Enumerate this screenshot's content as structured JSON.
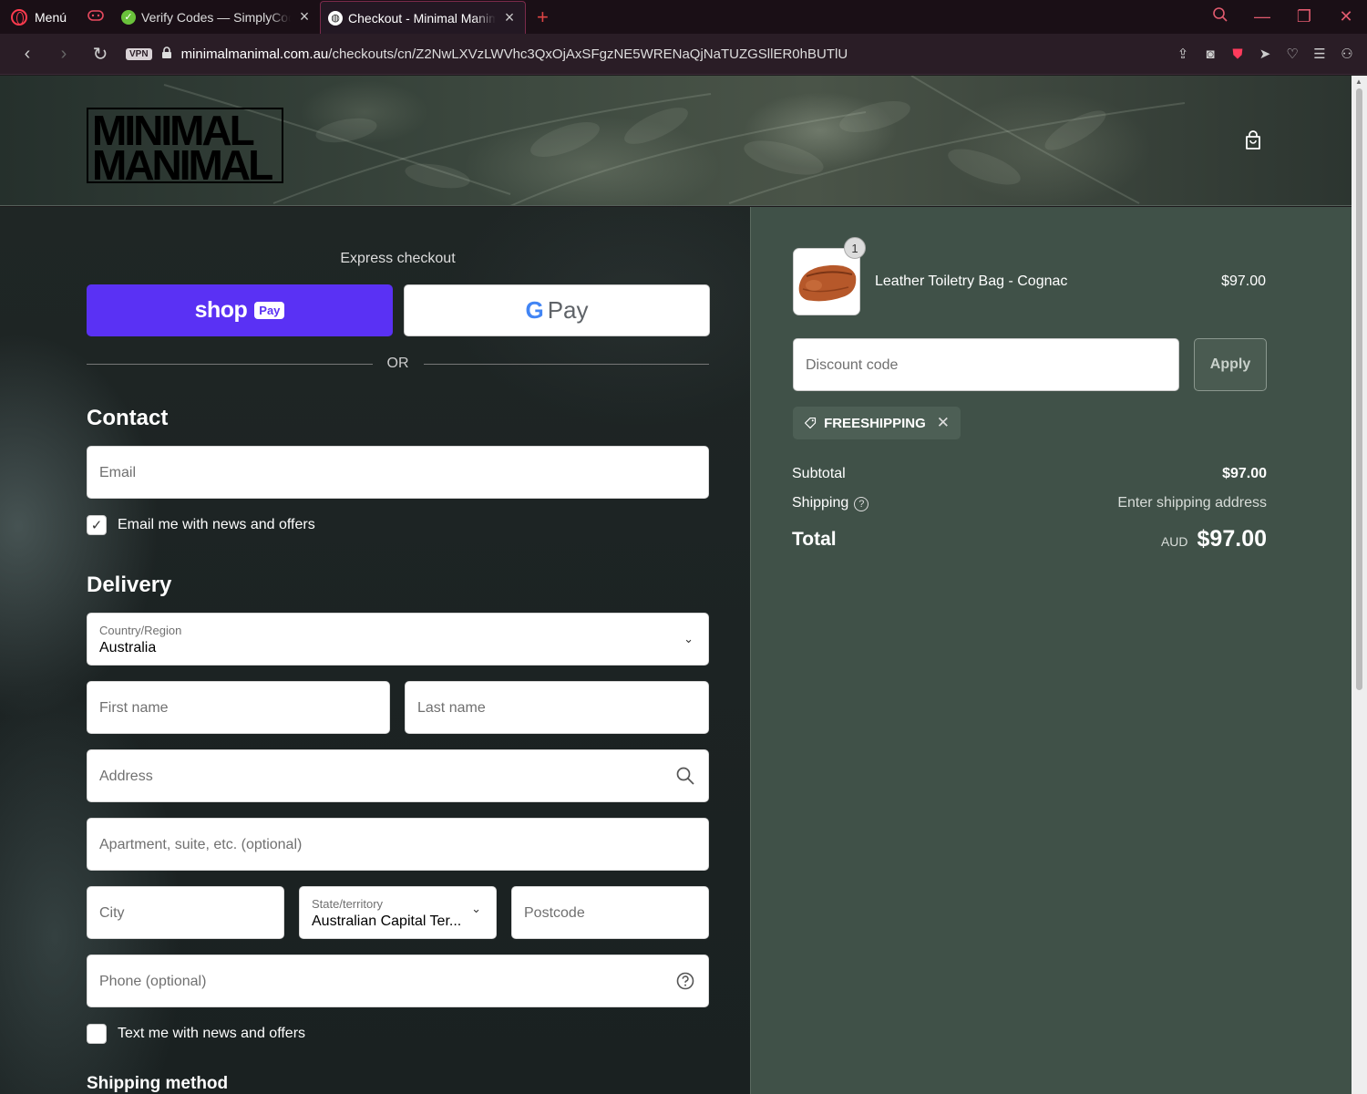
{
  "browser": {
    "menu_label": "Menú",
    "tabs": [
      {
        "title": "Verify Codes — SimplyCodes"
      },
      {
        "title": "Checkout - Minimal Manimal"
      }
    ],
    "vpn_label": "VPN",
    "url_host": "minimalmanimal.com.au",
    "url_path": "/checkouts/cn/Z2NwLXVzLWVhc3QxOjAxSFgzNE5WRENaQjNaTUZGSllER0hBUTlU"
  },
  "header": {
    "logo_line1": "MINIMAL",
    "logo_line2": "MANIMAL"
  },
  "checkout": {
    "express_label": "Express checkout",
    "shop_pay_word": "shop",
    "shop_pay_badge": "Pay",
    "gpay_g": "G",
    "gpay_word": "Pay",
    "or_label": "OR",
    "contact_heading": "Contact",
    "email_placeholder": "Email",
    "email_news_label": "Email me with news and offers",
    "email_news_checked": true,
    "delivery_heading": "Delivery",
    "country_label": "Country/Region",
    "country_value": "Australia",
    "first_name_placeholder": "First name",
    "last_name_placeholder": "Last name",
    "address_placeholder": "Address",
    "apartment_placeholder": "Apartment, suite, etc. (optional)",
    "city_placeholder": "City",
    "state_label": "State/territory",
    "state_value": "Australian Capital Ter...",
    "postcode_placeholder": "Postcode",
    "phone_placeholder": "Phone (optional)",
    "text_news_label": "Text me with news and offers",
    "text_news_checked": false,
    "shipping_method_heading": "Shipping method"
  },
  "summary": {
    "item_quantity": "1",
    "item_name": "Leather Toiletry Bag - Cognac",
    "item_price": "$97.00",
    "discount_placeholder": "Discount code",
    "apply_label": "Apply",
    "applied_code": "FREESHIPPING",
    "subtotal_label": "Subtotal",
    "subtotal_value": "$97.00",
    "shipping_label": "Shipping",
    "shipping_value": "Enter shipping address",
    "total_label": "Total",
    "total_currency": "AUD",
    "total_value": "$97.00"
  },
  "colors": {
    "shop_pay": "#5a31f4",
    "summary_bg": "#405148",
    "browser_accent": "#ff3b4e"
  }
}
